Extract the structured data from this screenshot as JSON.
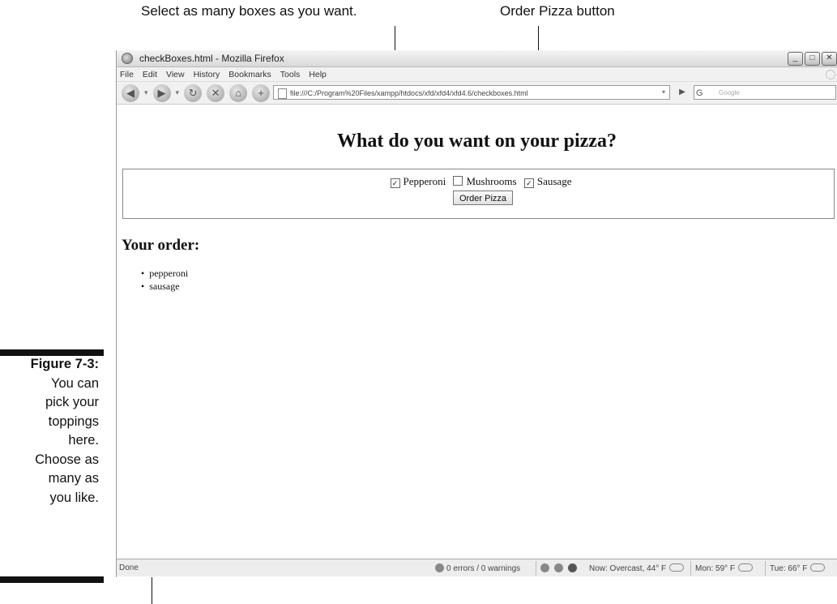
{
  "callouts": {
    "checkboxes": "Select as many boxes as you want.",
    "order_button": "Order Pizza button"
  },
  "caption": {
    "label": "Figure 7-3:",
    "lines": [
      "You can",
      "pick your",
      "toppings",
      "here.",
      "Choose as",
      "many as",
      "you like."
    ]
  },
  "window": {
    "title": "checkBoxes.html - Mozilla Firefox",
    "controls": [
      "_",
      "□",
      "✕"
    ]
  },
  "menu": [
    "File",
    "Edit",
    "View",
    "History",
    "Bookmarks",
    "Tools",
    "Help"
  ],
  "nav": {
    "url": "file:///C:/Program%20Files/xampp/htdocs/xfd/xfd4/xfd4.6/checkboxes.html",
    "search_engine": "G",
    "search_placeholder": "Google"
  },
  "page": {
    "heading": "What do you want on your pizza?",
    "toppings": [
      {
        "label": "Pepperoni",
        "checked": true
      },
      {
        "label": "Mushrooms",
        "checked": false
      },
      {
        "label": "Sausage",
        "checked": true
      }
    ],
    "button": "Order Pizza",
    "order_heading": "Your order:",
    "order_items": [
      "pepperoni",
      "sausage"
    ]
  },
  "status": {
    "done": "Done",
    "errors": "0 errors / 0 warnings",
    "weather_now": "Now: Overcast, 44° F",
    "weather_mon": "Mon: 59° F",
    "weather_tue": "Tue: 66° F"
  }
}
